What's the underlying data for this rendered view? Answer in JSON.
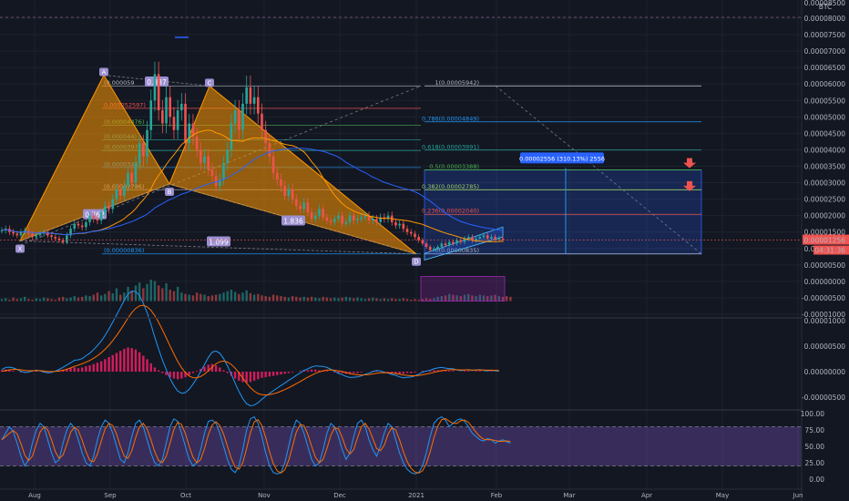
{
  "chart_data": {
    "type": "candlestick",
    "currency_label": "BTC",
    "x_ticks": [
      "Aug",
      "Sep",
      "Oct",
      "Nov",
      "Dec",
      "2021",
      "Feb",
      "Mar",
      "Apr",
      "May",
      "Jun"
    ],
    "price_axis": {
      "ticks": [
        "0.00008500",
        "0.00008000",
        "0.00007500",
        "0.00007000",
        "0.00006500",
        "0.00006000",
        "0.00005500",
        "0.00005000",
        "0.00004500",
        "0.00004000",
        "0.00003500",
        "0.00003000",
        "0.00002500",
        "0.00002000",
        "0.00001500",
        "0.00001000",
        "0.00000500",
        "0.00000000",
        "-0.00000500",
        "-0.00001000"
      ],
      "ylim": [
        -1e-05,
        8.5e-05
      ],
      "current_price": "0.00001256",
      "countdown": "04:31:36"
    },
    "candles_close": [
      1.55,
      1.6,
      1.5,
      1.45,
      1.4,
      1.5,
      1.55,
      1.45,
      1.35,
      1.4,
      1.45,
      1.5,
      1.4,
      1.35,
      1.3,
      1.25,
      1.2,
      1.4,
      1.6,
      1.75,
      1.7,
      1.65,
      1.8,
      2.0,
      1.9,
      1.85,
      2.1,
      2.3,
      2.2,
      2.5,
      2.8,
      2.6,
      2.9,
      3.3,
      3.0,
      3.6,
      4.2,
      3.8,
      4.6,
      5.5,
      6.3,
      5.2,
      4.8,
      5.6,
      5.0,
      4.6,
      5.2,
      5.4,
      4.2,
      4.8,
      4.4,
      4.0,
      3.6,
      3.8,
      3.4,
      3.2,
      2.9,
      3.1,
      3.6,
      4.0,
      4.8,
      5.2,
      4.6,
      5.4,
      5.9,
      5.4,
      5.6,
      5.1,
      4.6,
      4.2,
      3.8,
      3.3,
      3.1,
      2.9,
      2.6,
      2.8,
      2.5,
      2.3,
      2.2,
      2.4,
      2.1,
      1.9,
      2.0,
      2.2,
      1.95,
      1.85,
      1.8,
      1.9,
      2.0,
      1.75,
      1.8,
      2.0,
      1.85,
      1.9,
      1.95,
      2.0,
      1.85,
      1.9,
      1.8,
      1.95,
      1.9,
      2.0,
      1.8,
      1.7,
      1.75,
      1.6,
      1.5,
      1.45,
      1.35,
      1.25,
      1.15,
      1.05,
      0.95,
      1.0,
      1.05,
      1.15,
      1.1,
      1.2,
      1.15,
      1.25,
      1.2,
      1.3,
      1.35,
      1.25,
      1.3,
      1.35,
      1.4,
      1.3,
      1.35,
      1.28,
      1.3,
      1.26
    ],
    "pattern": {
      "points": [
        {
          "label": "X",
          "price": 1.23e-05
        },
        {
          "label": "A",
          "price": 6.27e-05
        },
        {
          "label": "B",
          "price": 2.96e-05
        },
        {
          "label": "C",
          "price": 5.94e-05
        },
        {
          "label": "D",
          "price": 8.35e-06
        }
      ],
      "ratios": [
        {
          "label": "0.887",
          "price": 6.06e-05
        },
        {
          "label": "0.762",
          "price": 2.03e-05
        },
        {
          "label": "1.836",
          "price": 1.84e-05
        },
        {
          "label": "1.099",
          "price": 1.2e-05
        }
      ]
    },
    "fib_right": [
      {
        "level": "1",
        "price": "0.00005942",
        "color": "#b2b5be"
      },
      {
        "level": "0.786",
        "price": "0.00004849",
        "color": "#2196f3"
      },
      {
        "level": "0.618",
        "price": "0.00003991",
        "color": "#26a69a"
      },
      {
        "level": "0.5",
        "price": "0.00003388",
        "color": "#4caf50"
      },
      {
        "level": "0.382",
        "price": "0.00002785",
        "color": "#9ccc65"
      },
      {
        "level": "0.236",
        "price": "0.00002040",
        "color": "#ef5350"
      },
      {
        "level": "0",
        "price": "0.00000835",
        "color": "#b2b5be"
      }
    ],
    "fib_left": [
      {
        "text": "(0.000059",
        "price": 5.94e-05,
        "color": "#b2b5be"
      },
      {
        "text": "0.000052597)",
        "price": 5.26e-05,
        "color": "#ef5350"
      },
      {
        "text": "(0.00004476)",
        "price": 4.75e-05,
        "color": "#4caf50"
      },
      {
        "text": "(0.000044)",
        "price": 4.3e-05,
        "color": "#26a69a"
      },
      {
        "text": "(0.0000397)",
        "price": 3.98e-05,
        "color": "#26a69a"
      },
      {
        "text": "(0.00003461)",
        "price": 3.461e-05,
        "color": "#2196f3"
      },
      {
        "text": "(0.00002786)",
        "price": 2.786e-05,
        "color": "#b2b5be"
      },
      {
        "text": "(0.00000836)",
        "price": 8.36e-06,
        "color": "#2196f3"
      }
    ],
    "measure_label": "0.00002556 (310.13%) 2556",
    "volume": [
      3,
      4,
      2,
      5,
      3,
      4,
      6,
      3,
      2,
      4,
      3,
      5,
      4,
      3,
      2,
      5,
      6,
      4,
      5,
      7,
      5,
      6,
      8,
      7,
      9,
      12,
      8,
      10,
      14,
      11,
      18,
      9,
      12,
      20,
      15,
      22,
      26,
      18,
      24,
      30,
      28,
      22,
      18,
      25,
      16,
      14,
      20,
      12,
      10,
      9,
      8,
      12,
      10,
      9,
      7,
      8,
      9,
      10,
      12,
      14,
      16,
      13,
      10,
      12,
      15,
      11,
      9,
      10,
      8,
      7,
      6,
      9,
      8,
      7,
      6,
      5,
      7,
      6,
      5,
      6,
      5,
      6,
      5,
      4,
      6,
      5,
      4,
      5,
      4,
      5,
      6,
      5,
      4,
      5,
      4,
      3,
      4,
      5,
      4,
      3,
      4,
      3,
      4,
      3,
      3,
      4,
      3,
      2,
      3,
      2,
      3,
      4,
      3,
      4,
      6,
      7,
      8,
      10,
      9,
      8,
      7,
      9,
      10,
      8,
      7,
      9,
      8,
      7,
      8,
      9,
      7,
      6,
      7,
      6
    ],
    "macd_hist": [
      0.2,
      0.3,
      0.2,
      0.1,
      0.0,
      -0.1,
      -0.1,
      0.0,
      0.1,
      0.1,
      0.0,
      -0.1,
      -0.1,
      0.0,
      0.1,
      0.2,
      0.3,
      0.4,
      0.5,
      0.6,
      0.5,
      0.6,
      0.8,
      0.9,
      1.1,
      1.3,
      1.5,
      1.8,
      2.1,
      2.4,
      2.7,
      3.0,
      3.3,
      3.5,
      3.4,
      3.2,
      2.8,
      2.3,
      1.8,
      1.2,
      0.6,
      0.2,
      -0.2,
      -0.5,
      -0.8,
      -1.0,
      -1.1,
      -1.0,
      -0.8,
      -0.5,
      -0.2,
      0.1,
      0.4,
      0.7,
      1.0,
      1.1,
      0.9,
      0.6,
      0.2,
      -0.2,
      -0.6,
      -1.0,
      -1.3,
      -1.5,
      -1.6,
      -1.5,
      -1.3,
      -1.1,
      -0.9,
      -0.8,
      -0.7,
      -0.6,
      -0.5,
      -0.4,
      -0.3,
      -0.2,
      -0.1,
      0.0,
      0.1,
      0.2,
      0.2,
      0.3,
      0.3,
      0.2,
      0.2,
      0.1,
      0.0,
      -0.1,
      -0.2,
      -0.2,
      -0.3,
      -0.3,
      -0.2,
      -0.2,
      -0.1,
      0.0,
      0.0,
      0.1,
      0.1,
      0.0,
      -0.1,
      -0.1,
      -0.2,
      -0.2,
      -0.3,
      -0.3,
      -0.2,
      -0.2,
      -0.1,
      0.0,
      0.1,
      0.1,
      0.1,
      0.2,
      0.2,
      0.2,
      0.1,
      0.1,
      0.1,
      0.0,
      0.0,
      0.1,
      0.1,
      0.0,
      0.1,
      0.1,
      0.0,
      0.0,
      0.1,
      0.0,
      0.0
    ],
    "macd_axis": [
      "0.00001000",
      "0.00000500",
      "0.00000000",
      "-0.00000500"
    ],
    "stoch_axis": [
      "100.00",
      "75.00",
      "50.00",
      "25.00",
      "0.00"
    ],
    "stoch_k": [
      60,
      70,
      80,
      72,
      55,
      35,
      20,
      30,
      55,
      75,
      85,
      80,
      60,
      40,
      25,
      30,
      55,
      75,
      85,
      78,
      60,
      40,
      25,
      20,
      35,
      60,
      80,
      90,
      85,
      70,
      50,
      30,
      25,
      40,
      65,
      85,
      90,
      80,
      60,
      40,
      25,
      20,
      30,
      55,
      80,
      92,
      88,
      70,
      50,
      30,
      20,
      25,
      45,
      70,
      88,
      90,
      85,
      70,
      50,
      30,
      15,
      10,
      20,
      45,
      75,
      92,
      95,
      85,
      65,
      40,
      20,
      10,
      8,
      10,
      25,
      50,
      75,
      90,
      85,
      70,
      50,
      30,
      20,
      25,
      45,
      70,
      85,
      80,
      65,
      45,
      30,
      40,
      65,
      85,
      90,
      80,
      60,
      45,
      35,
      50,
      70,
      85,
      80,
      60,
      40,
      25,
      15,
      10,
      8,
      10,
      20,
      40,
      65,
      85,
      92,
      95,
      90,
      80,
      85,
      90,
      92,
      88,
      80,
      70,
      65,
      60,
      58,
      62,
      60,
      55,
      58,
      60,
      57,
      55
    ]
  }
}
